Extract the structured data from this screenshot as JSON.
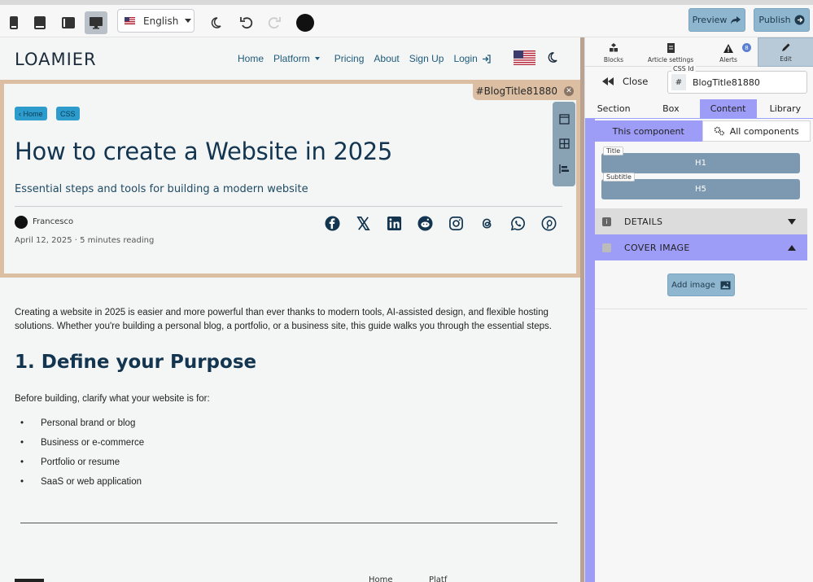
{
  "toolbar": {
    "language": "English",
    "preview_label": "Preview",
    "publish_label": "Publish"
  },
  "site": {
    "logo": "LOAMIER",
    "nav": {
      "home": "Home",
      "platform": "Platform",
      "pricing": "Pricing",
      "about": "About",
      "signup": "Sign Up",
      "login": "Login"
    }
  },
  "blog": {
    "css_label": "#BlogTitle81880",
    "tags": [
      "‹ Home",
      "CSS"
    ],
    "title": "How to create a Website in 2025",
    "subtitle": "Essential steps and tools for building a modern website",
    "author": "Francesco",
    "date": "April 12, 2025",
    "reading": "5 minutes reading",
    "share_icons": [
      "facebook-icon",
      "x-icon",
      "linkedin-icon",
      "reddit-icon",
      "instagram-icon",
      "threads-icon",
      "whatsapp-icon",
      "pinterest-icon"
    ]
  },
  "article": {
    "intro": "Creating a website in 2025 is easier and more powerful than ever thanks to modern tools, AI-assisted design, and flexible hosting solutions. Whether you're building a personal blog, a portfolio, or a business site, this guide walks you through the essential steps.",
    "heading": "1. Define your Purpose",
    "lead": "Before building, clarify what your website is for:",
    "items": [
      "Personal brand or blog",
      "Business or e-commerce",
      "Portfolio or resume",
      "SaaS or web application"
    ]
  },
  "footer_partial": {
    "a": "Home",
    "b": "Platf"
  },
  "panel": {
    "tabs": {
      "blocks": "Blocks",
      "article_settings": "Article settings",
      "alerts": "Alerts",
      "alerts_count": "8",
      "edit": "Edit"
    },
    "close_label": "Close",
    "css_id_label": "CSS Id",
    "css_id_hash": "#",
    "css_id_value": "BlogTitle81880",
    "section_tabs": {
      "section": "Section",
      "box": "Box",
      "content": "Content",
      "library": "Library"
    },
    "component_tabs": {
      "this": "This component",
      "all": "All components"
    },
    "fields": {
      "title_label": "Title",
      "title_value": "H1",
      "subtitle_label": "Subtitle",
      "subtitle_value": "H5"
    },
    "accordions": {
      "details": "DETAILS",
      "cover": "COVER IMAGE"
    },
    "add_image_label": "Add image"
  },
  "colors": {
    "accent_purple": "#9d9cf7",
    "accent_blue": "#8fb6cf",
    "selection_border": "#dcbfa3",
    "title_navy": "#133550"
  }
}
